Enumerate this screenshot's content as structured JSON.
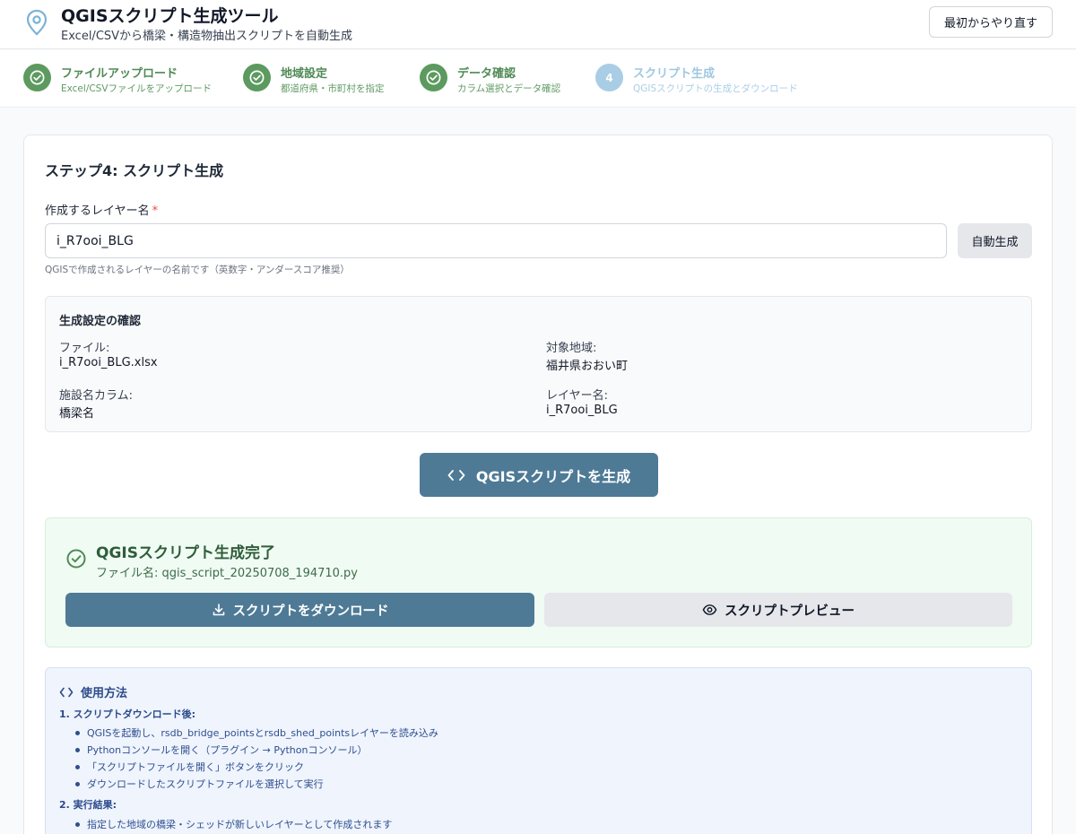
{
  "header": {
    "title": "QGISスクリプト生成ツール",
    "subtitle": "Excel/CSVから橋梁・構造物抽出スクリプトを自動生成",
    "restart_label": "最初からやり直す"
  },
  "steps": [
    {
      "title": "ファイルアップロード",
      "desc": "Excel/CSVファイルをアップロード",
      "status": "done"
    },
    {
      "title": "地域設定",
      "desc": "都道府県・市町村を指定",
      "status": "done"
    },
    {
      "title": "データ確認",
      "desc": "カラム選択とデータ確認",
      "status": "done"
    },
    {
      "title": "スクリプト生成",
      "desc": "QGISスクリプトの生成とダウンロード",
      "status": "current",
      "number": "4"
    }
  ],
  "main": {
    "heading": "ステップ4: スクリプト生成",
    "layer_label": "作成するレイヤー名",
    "required_mark": "*",
    "layer_value": "i_R7ooi_BLG",
    "auto_label": "自動生成",
    "hint": "QGISで作成されるレイヤーの名前です（英数字・アンダースコア推奨）"
  },
  "settings": {
    "title": "生成設定の確認",
    "file_label": "ファイル:",
    "file_value": "i_R7ooi_BLG.xlsx",
    "region_label": "対象地域:",
    "region_value": "福井県おおい町",
    "column_label": "施設名カラム:",
    "column_value": "橋梁名",
    "layer_label": "レイヤー名:",
    "layer_value": "i_R7ooi_BLG"
  },
  "generate_label": "QGISスクリプトを生成",
  "success": {
    "title": "QGISスクリプト生成完了",
    "filename": "ファイル名: qgis_script_20250708_194710.py",
    "download_label": "スクリプトをダウンロード",
    "preview_label": "スクリプトプレビュー"
  },
  "usage": {
    "title": "使用方法",
    "section1": "1. スクリプトダウンロード後:",
    "items1": [
      "QGISを起動し、rsdb_bridge_pointsとrsdb_shed_pointsレイヤーを読み込み",
      "Pythonコンソールを開く（プラグイン → Pythonコンソール）",
      "「スクリプトファイルを開く」ボタンをクリック",
      "ダウンロードしたスクリプトファイルを選択して実行"
    ],
    "section2": "2. 実行結果:",
    "items2": [
      "指定した地域の橋梁・シェッドが新しいレイヤーとして作成されます"
    ]
  },
  "colors": {
    "primary": "#4e7a96",
    "success_green": "#5c9a5f",
    "pending_blue": "#a9cde4",
    "usage_text": "#2e4f8f"
  }
}
